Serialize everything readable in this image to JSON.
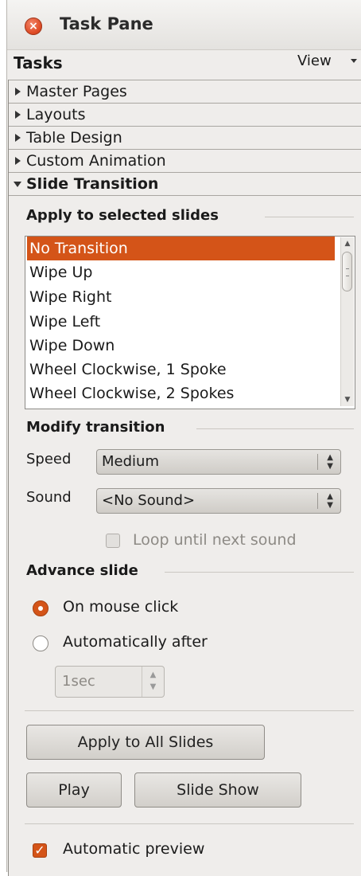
{
  "window": {
    "title": "Task Pane"
  },
  "tasks_bar": {
    "label": "Tasks",
    "view_label": "View"
  },
  "decks": [
    {
      "label": "Master Pages",
      "open": false
    },
    {
      "label": "Layouts",
      "open": false
    },
    {
      "label": "Table Design",
      "open": false
    },
    {
      "label": "Custom Animation",
      "open": false
    },
    {
      "label": "Slide Transition",
      "open": true
    }
  ],
  "slide_transition": {
    "apply_section": "Apply to selected slides",
    "transitions": [
      "No Transition",
      "Wipe Up",
      "Wipe Right",
      "Wipe Left",
      "Wipe Down",
      "Wheel Clockwise, 1 Spoke",
      "Wheel Clockwise, 2 Spokes"
    ],
    "selected_index": 0,
    "modify_section": "Modify transition",
    "speed_label": "Speed",
    "speed_value": "Medium",
    "sound_label": "Sound",
    "sound_value": "<No Sound>",
    "loop_label": "Loop until next sound",
    "loop_checked": false,
    "advance_section": "Advance slide",
    "on_click_label": "On mouse click",
    "auto_label": "Automatically after",
    "advance_mode": "on_click",
    "auto_value": "1sec",
    "apply_all_label": "Apply to All Slides",
    "play_label": "Play",
    "slideshow_label": "Slide Show",
    "auto_preview_label": "Automatic preview",
    "auto_preview_checked": true
  },
  "colors": {
    "accent": "#d45418",
    "pane_bg": "#efedeb"
  },
  "icons": {
    "close": "close-icon",
    "view_dropdown": "chevron-down-icon",
    "collapsed": "triangle-right-icon",
    "expanded": "triangle-down-icon"
  }
}
